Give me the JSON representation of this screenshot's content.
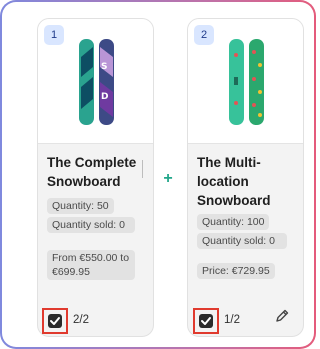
{
  "products": [
    {
      "position": "1",
      "title": "The Complete Snowboard",
      "quantity": "Quantity: 50",
      "quantity_sold": "Quantity sold: 0",
      "price": "From €550.00 to €699.95",
      "selected_count": "2/2",
      "checked": true,
      "image_icon": "snowboard-image"
    },
    {
      "position": "2",
      "title": "The Multi-location Snowboard",
      "quantity": "Quantity: 100",
      "quantity_sold": "Quantity sold: 0",
      "price": "Price: €729.95",
      "selected_count": "1/2",
      "checked": true,
      "image_icon": "snowboard-image"
    }
  ],
  "connector_icon": "plus-icon",
  "plus_symbol": "+",
  "edit_icon": "pencil-icon",
  "colors": {
    "accent": "#22a68a",
    "badge_bg": "#d9e6ff",
    "checkbox": "#2b2b2b",
    "highlight": "#e03a2e"
  }
}
